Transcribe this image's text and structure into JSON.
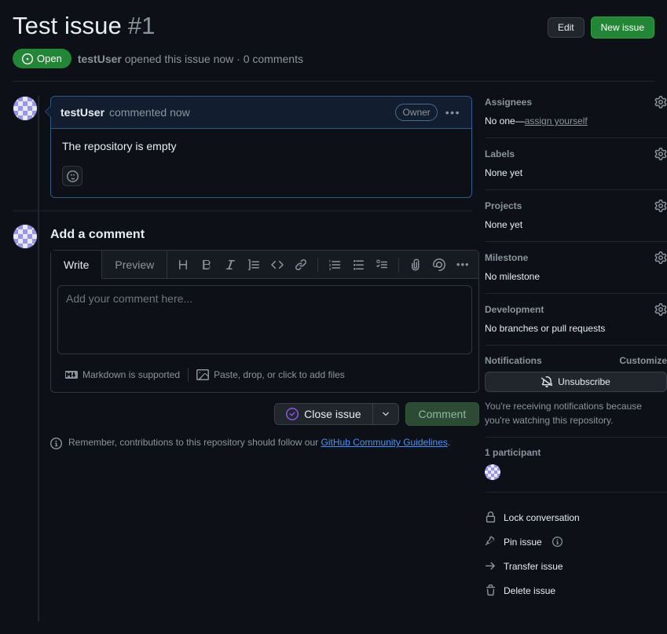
{
  "header": {
    "title": "Test  issue",
    "number": "#1",
    "edit_label": "Edit",
    "new_issue_label": "New issue",
    "state": "Open",
    "state_icon": "issue-opened-icon",
    "state_color": "#238636",
    "meta_author": "testUser",
    "meta_text": "opened this issue now · 0 comments"
  },
  "comment": {
    "author": "testUser",
    "meta": "commented now",
    "badge": "Owner",
    "kebab": "•••",
    "body": "The repository is empty",
    "reaction_icon": "smiley-icon"
  },
  "composer": {
    "heading": "Add a comment",
    "tabs": [
      {
        "label": "Write",
        "active": true
      },
      {
        "label": "Preview",
        "active": false
      }
    ],
    "tools": [
      {
        "name": "heading-icon",
        "glyph": "H"
      },
      {
        "name": "bold-icon",
        "glyph": "B"
      },
      {
        "name": "italic-icon",
        "glyph": "I"
      },
      {
        "name": "quote-icon",
        "glyph": "quote"
      },
      {
        "name": "code-icon",
        "glyph": "<>"
      },
      {
        "name": "link-icon",
        "glyph": "link"
      },
      {
        "name": "ordered-list-icon",
        "glyph": "ol"
      },
      {
        "name": "unordered-list-icon",
        "glyph": "ul"
      },
      {
        "name": "task-list-icon",
        "glyph": "task"
      },
      {
        "name": "attach-file-icon",
        "glyph": "clip"
      },
      {
        "name": "mention-icon",
        "glyph": "@"
      },
      {
        "name": "more-options-icon",
        "glyph": "•••"
      }
    ],
    "placeholder": "Add your comment here...",
    "value": "",
    "markdown_note": "Markdown is supported",
    "attach_note": "Paste, drop, or click to add files",
    "close_label": "Close issue",
    "close_icon": "issue-closed-icon",
    "close_icon_color": "#8957e5",
    "caret_icon": "chevron-down-icon",
    "comment_label": "Comment",
    "guidelines_prefix": "Remember, contributions to this repository should follow our ",
    "guidelines_link": "GitHub Community Guidelines",
    "guidelines_suffix": "."
  },
  "sidebar": {
    "sections": [
      {
        "title": "Assignees",
        "value": "No one—",
        "link": "assign yourself"
      },
      {
        "title": "Labels",
        "value": "None yet"
      },
      {
        "title": "Projects",
        "value": "None yet"
      },
      {
        "title": "Milestone",
        "value": "No milestone"
      },
      {
        "title": "Development",
        "value": "No branches or pull requests"
      }
    ],
    "notifications": {
      "title": "Notifications",
      "customize": "Customize",
      "button": "Unsubscribe",
      "button_icon": "bell-slash-icon",
      "note": "You're receiving notifications because you're watching this repository."
    },
    "participants": {
      "count_label": "1 participant"
    },
    "actions": [
      {
        "label": "Lock conversation",
        "icon": "lock-icon"
      },
      {
        "label": "Pin issue",
        "icon": "pin-icon",
        "info": true
      },
      {
        "label": "Transfer issue",
        "icon": "arrow-right-icon"
      },
      {
        "label": "Delete issue",
        "icon": "trash-icon"
      }
    ]
  }
}
